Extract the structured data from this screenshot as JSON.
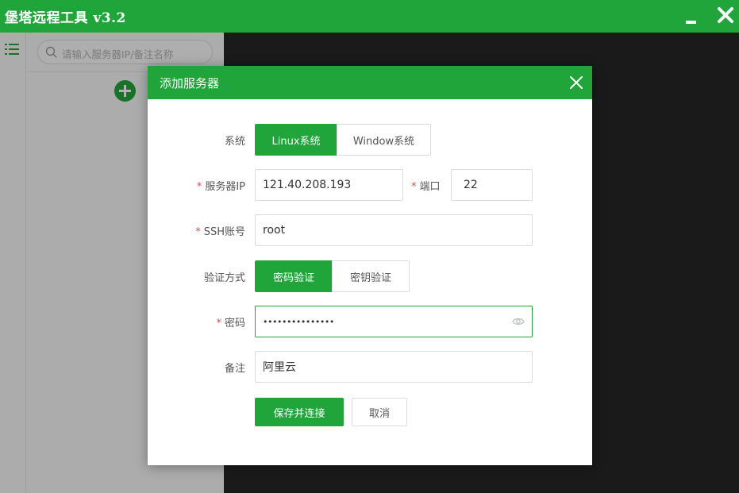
{
  "titlebar": {
    "title": "堡塔远程工具 v3.2"
  },
  "sidebar": {
    "search_placeholder": "请输入服务器IP/备注名称"
  },
  "colors": {
    "brand": "#20a53a",
    "required": "#ef4444"
  },
  "dialog": {
    "title": "添加服务器",
    "system": {
      "label": "系统",
      "options": [
        "Linux系统",
        "Window系统"
      ],
      "selected": "Linux系统"
    },
    "ip": {
      "label": "服务器IP",
      "value": "121.40.208.193"
    },
    "port": {
      "label": "端口",
      "value": "22"
    },
    "ssh_account": {
      "label": "SSH账号",
      "value": "root"
    },
    "auth_method": {
      "label": "验证方式",
      "options": [
        "密码验证",
        "密钥验证"
      ],
      "selected": "密码验证"
    },
    "password": {
      "label": "密码",
      "value": "•••••••••••••••"
    },
    "remark": {
      "label": "备注",
      "value": "阿里云"
    },
    "save_button": "保存并连接",
    "cancel_button": "取消"
  }
}
